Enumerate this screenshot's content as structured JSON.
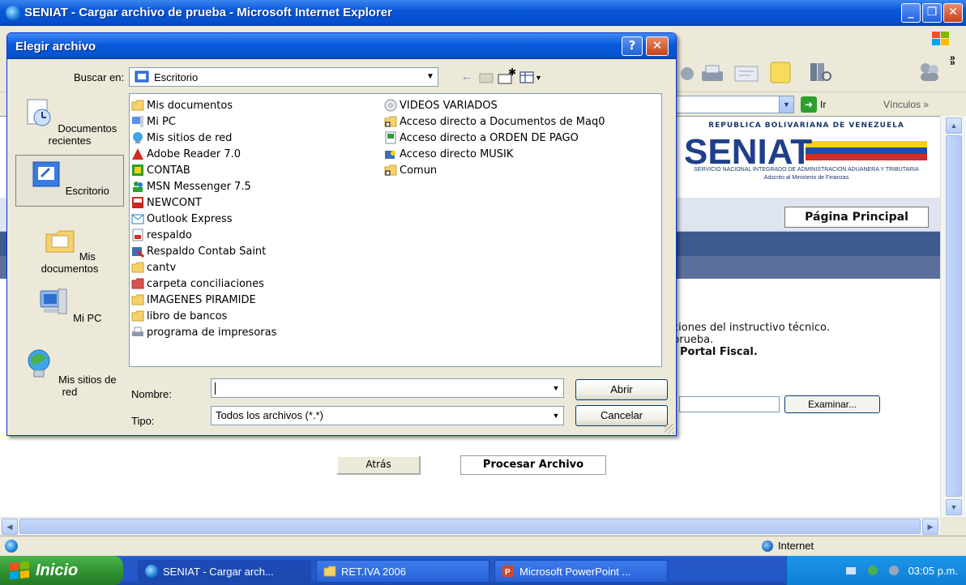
{
  "browser": {
    "title": "SENIAT - Cargar archivo de prueba - Microsoft Internet Explorer",
    "go_label": "Ir",
    "links_label": "Vínculos",
    "status_zone": "Internet"
  },
  "page": {
    "gov_banner": "REPUBLICA BOLIVARIANA DE VENEZUELA",
    "logo_text": "SENIAT",
    "logo_sub1": "SERVICIO NACIONAL INTEGRADO DE ADMINISTRACION ADUANERA Y TRIBUTARIA",
    "logo_sub2": "Adscrito al Ministerio de Finanzas",
    "home_button": "Página Principal",
    "instr_line1": "ciones del instructivo técnico.",
    "instr_line2": "prueba.",
    "instr_line3": "l Portal Fiscal.",
    "browse_button": "Examinar...",
    "back_button": "Atrás",
    "process_button": "Procesar Archivo"
  },
  "dialog": {
    "title": "Elegir archivo",
    "help_label": "?",
    "close_label": "✕",
    "look_in_label": "Buscar en:",
    "look_in_value": "Escritorio",
    "places": [
      {
        "label": "Documentos recientes"
      },
      {
        "label": "Escritorio"
      },
      {
        "label": "Mis documentos"
      },
      {
        "label": "Mi PC"
      },
      {
        "label": "Mis sitios de red"
      }
    ],
    "files_col1": [
      "Mis documentos",
      "Mi PC",
      "Mis sitios de red",
      "Adobe Reader 7.0",
      "CONTAB",
      "MSN Messenger 7.5",
      "NEWCONT",
      "Outlook Express",
      "respaldo",
      "Respaldo Contab Saint",
      "cantv",
      "carpeta conciliaciones",
      "IMAGENES PIRAMIDE",
      "libro de bancos",
      "programa de impresoras"
    ],
    "files_col2": [
      "VIDEOS VARIADOS",
      "Acceso directo a Documentos de Maq0",
      "Acceso directo a ORDEN DE PAGO",
      "Acceso directo MUSIK",
      "Comun"
    ],
    "name_label": "Nombre:",
    "name_value": "",
    "type_label": "Tipo:",
    "type_value": "Todos los archivos (*.*)",
    "open_button": "Abrir",
    "cancel_button": "Cancelar"
  },
  "taskbar": {
    "start_label": "Inicio",
    "tasks": [
      {
        "label": "SENIAT - Cargar arch..."
      },
      {
        "label": "RET.IVA 2006"
      },
      {
        "label": "Microsoft PowerPoint ..."
      }
    ],
    "clock": "03:05 p.m."
  },
  "colors": {
    "title_blue": "#0A57D8",
    "start_green": "#2E8F2E",
    "nav_dark": "#3F5A8E",
    "xp_face": "#ECE9D8"
  }
}
